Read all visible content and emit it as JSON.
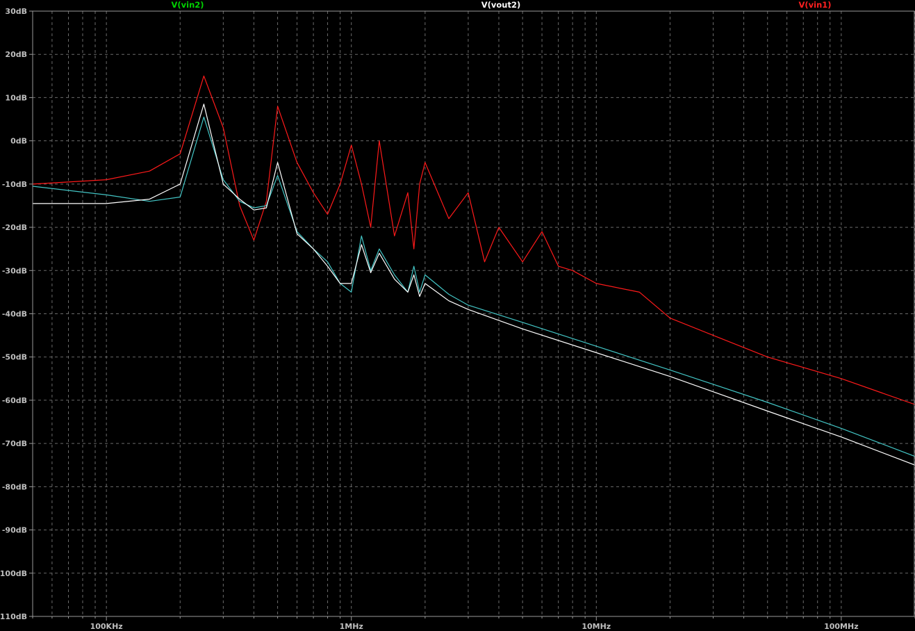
{
  "colors": {
    "background": "#000000",
    "grid": "#6b6b6b",
    "frame": "#9a9a9a",
    "tick_text": "#bfbfbf"
  },
  "chart_data": {
    "type": "line",
    "title": "",
    "xlabel": "",
    "ylabel": "",
    "x_scale": "log",
    "xlim": [
      50000,
      200000000
    ],
    "ylim": [
      -110,
      30
    ],
    "grid": true,
    "legend_position": "top",
    "x_ticks": [
      "100KHz",
      "1MHz",
      "10MHz",
      "100MHz"
    ],
    "y_ticks": [
      "30dB",
      "20dB",
      "10dB",
      "0dB",
      "-10dB",
      "-20dB",
      "-30dB",
      "-40dB",
      "-50dB",
      "-60dB",
      "-70dB",
      "-80dB",
      "-90dB",
      "100dB",
      "110dB"
    ],
    "series": [
      {
        "name": "V(vin2)",
        "color": "#00d200",
        "line_color": "#43c6c6",
        "x": [
          50000,
          100000,
          150000,
          200000,
          250000,
          300000,
          350000,
          400000,
          450000,
          500000,
          600000,
          700000,
          800000,
          900000,
          1000000,
          1100000,
          1200000,
          1300000,
          1500000,
          1700000,
          1800000,
          1900000,
          2000000,
          2500000,
          3000000,
          5000000,
          10000000,
          20000000,
          50000000,
          100000000,
          200000000
        ],
        "y": [
          -10.5,
          -12.5,
          -14,
          -13,
          5.5,
          -9,
          -14,
          -15.5,
          -15,
          -8,
          -21,
          -25,
          -28,
          -33,
          -35,
          -22,
          -30,
          -25,
          -31,
          -35,
          -29,
          -35,
          -31,
          -35.5,
          -38,
          -42,
          -47.5,
          -53,
          -60.5,
          -66.5,
          -73
        ]
      },
      {
        "name": "V(vout2)",
        "color": "#ffffff",
        "line_color": "#ffffff",
        "x": [
          50000,
          100000,
          150000,
          200000,
          250000,
          300000,
          350000,
          400000,
          450000,
          500000,
          600000,
          700000,
          800000,
          900000,
          1000000,
          1100000,
          1200000,
          1300000,
          1500000,
          1700000,
          1800000,
          1900000,
          2000000,
          2500000,
          3000000,
          5000000,
          10000000,
          20000000,
          50000000,
          100000000,
          200000000
        ],
        "y": [
          -14.5,
          -14.5,
          -13.5,
          -10,
          8.5,
          -10,
          -13.5,
          -16,
          -15.5,
          -5,
          -21.5,
          -25,
          -29,
          -33,
          -33,
          -24,
          -30.5,
          -26,
          -32,
          -35,
          -31,
          -36,
          -33,
          -37,
          -39,
          -43.5,
          -49,
          -54.5,
          -62.5,
          -68.5,
          -75
        ]
      },
      {
        "name": "V(vin1)",
        "color": "#ff2020",
        "line_color": "#ff1a1a",
        "x": [
          50000,
          100000,
          150000,
          200000,
          250000,
          300000,
          350000,
          400000,
          450000,
          500000,
          600000,
          700000,
          800000,
          900000,
          1000000,
          1100000,
          1200000,
          1300000,
          1500000,
          1700000,
          1800000,
          1900000,
          2000000,
          2500000,
          3000000,
          3500000,
          4000000,
          5000000,
          6000000,
          7000000,
          8000000,
          10000000,
          15000000,
          20000000,
          30000000,
          50000000,
          100000000,
          200000000
        ],
        "y": [
          -10,
          -9,
          -7,
          -3,
          15,
          3,
          -15,
          -23,
          -14,
          8,
          -5,
          -12,
          -17,
          -10,
          -1,
          -10,
          -20,
          0,
          -22,
          -12,
          -25,
          -10,
          -5,
          -18,
          -12,
          -28,
          -20,
          -28,
          -21,
          -29,
          -30,
          -33,
          -35,
          -41,
          -45,
          -50,
          -55,
          -61
        ]
      }
    ]
  }
}
